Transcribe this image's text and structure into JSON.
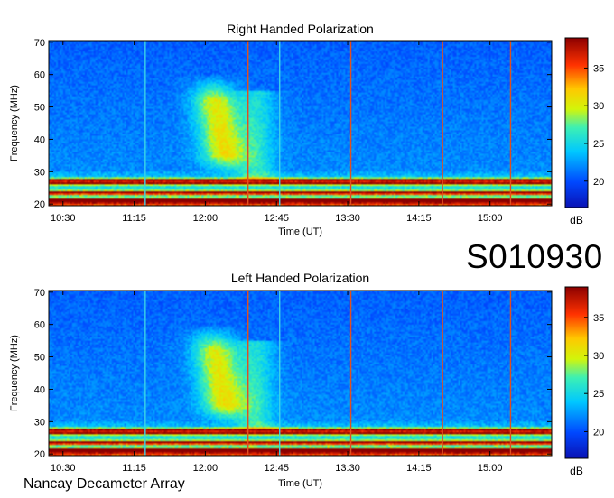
{
  "event_id": "S010930",
  "credit": "Nancay Decameter Array",
  "chart_data": [
    {
      "type": "heatmap",
      "title": "Right Handed Polarization",
      "xlabel": "Time (UT)",
      "ylabel": "Frequency (MHz)",
      "x_ticks": [
        "10:30",
        "11:15",
        "12:00",
        "12:45",
        "13:30",
        "14:15",
        "15:00"
      ],
      "x_tick_minutes": [
        630,
        675,
        720,
        765,
        810,
        855,
        900
      ],
      "xlim": [
        621,
        939
      ],
      "y_ticks": [
        20,
        30,
        40,
        50,
        60,
        70
      ],
      "ylim": [
        19.5,
        70.5
      ],
      "colorbar": {
        "label": "dB",
        "ticks": [
          20,
          25,
          30,
          35
        ],
        "range": [
          16.5,
          39
        ]
      },
      "features": {
        "burst_center_minute": 727,
        "burst_freq_range_mhz": [
          29,
          60
        ],
        "interference_bands_mhz": [
          21,
          23.5,
          26.5,
          27.5
        ],
        "vertical_lines_minutes": [
          682,
          747,
          767,
          812,
          870,
          913
        ]
      }
    },
    {
      "type": "heatmap",
      "title": "Left Handed Polarization",
      "xlabel": "Time (UT)",
      "ylabel": "Frequency (MHz)",
      "x_ticks": [
        "10:30",
        "11:15",
        "12:00",
        "12:45",
        "13:30",
        "14:15",
        "15:00"
      ],
      "x_tick_minutes": [
        630,
        675,
        720,
        765,
        810,
        855,
        900
      ],
      "xlim": [
        621,
        939
      ],
      "y_ticks": [
        20,
        30,
        40,
        50,
        60,
        70
      ],
      "ylim": [
        19.5,
        70.5
      ],
      "colorbar": {
        "label": "dB",
        "ticks": [
          20,
          25,
          30,
          35
        ],
        "range": [
          16.5,
          39
        ]
      },
      "features": {
        "burst_center_minute": 727,
        "burst_freq_range_mhz": [
          29,
          60
        ],
        "interference_bands_mhz": [
          21,
          23.5,
          26.5,
          27.5
        ],
        "vertical_lines_minutes": [
          682,
          747,
          767,
          812,
          870,
          913
        ]
      }
    }
  ]
}
